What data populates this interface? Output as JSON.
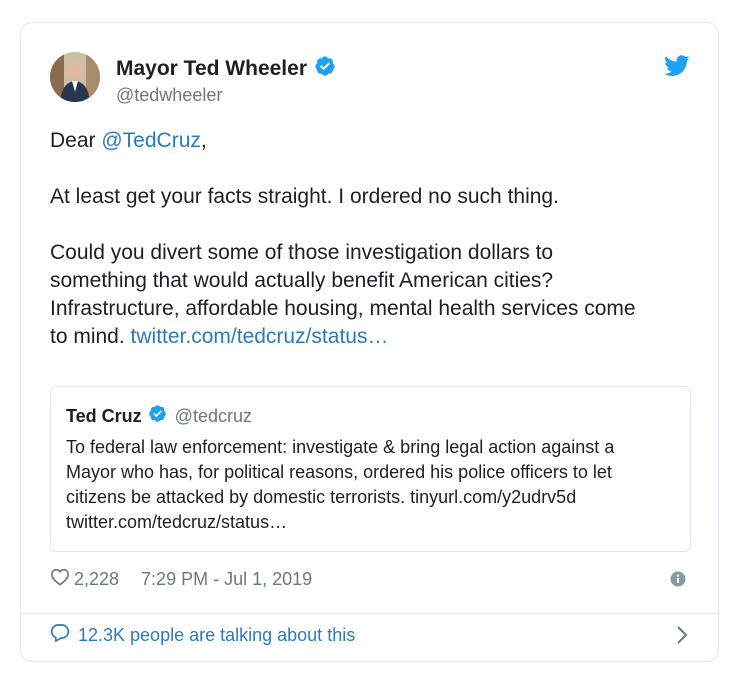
{
  "tweet": {
    "author_name": "Mayor Ted Wheeler",
    "author_handle": "@tedwheeler",
    "greeting_prefix": "Dear ",
    "greeting_mention": "@TedCruz",
    "greeting_suffix": ",",
    "paragraph_2": "At least get your facts straight. I ordered no such thing.",
    "paragraph_3_lines": [
      "Could you divert some of those investigation dollars to",
      "something that would actually benefit American cities?",
      "Infrastructure, affordable housing, mental health services come"
    ],
    "paragraph_3_last_prefix": "to mind. ",
    "paragraph_3_link": "twitter.com/tedcruz/status…",
    "likes": "2,228",
    "timestamp": "7:29 PM - Jul 1, 2019",
    "talking": "12.3K people are talking about this"
  },
  "quoted": {
    "author_name": "Ted Cruz",
    "author_handle": "@tedcruz",
    "lines": [
      "To federal law enforcement:  investigate & bring legal action against a",
      "Mayor who has, for political reasons, ordered his police officers to let",
      "citizens be attacked by domestic terrorists.  tinyurl.com/y2udrv5d",
      "twitter.com/tedcruz/status…"
    ]
  },
  "icons": {
    "verified": "verified-badge-icon",
    "twitter": "twitter-bird-icon",
    "heart": "heart-icon",
    "info": "info-icon",
    "comment": "comment-bubble-icon",
    "chevron": "chevron-right-icon"
  },
  "colors": {
    "link": "#2b7bb9",
    "verified": "#1da1f2",
    "muted": "#697882",
    "border": "#e1e8ed"
  }
}
